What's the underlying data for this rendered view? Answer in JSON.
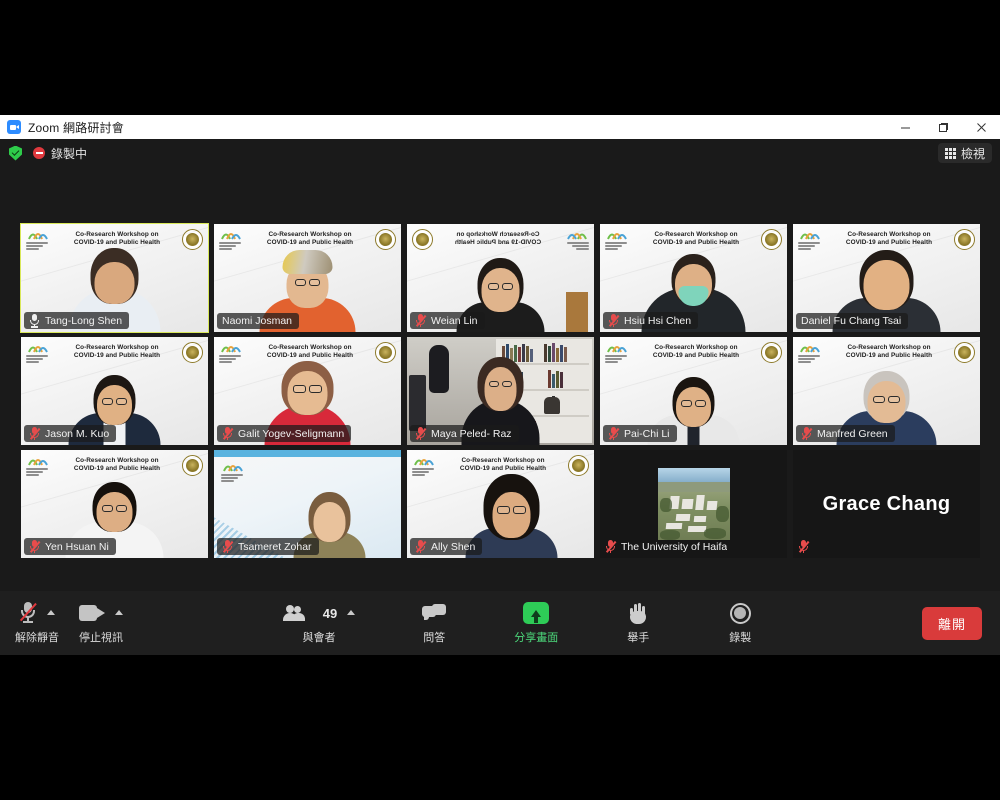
{
  "window": {
    "title": "Zoom 網路研討會",
    "app_icon": "zoom-video-icon",
    "minimize_label": "—",
    "maximize_label": "❐",
    "close_label": "✕"
  },
  "status_bar": {
    "encryption_icon": "green-shield-check-icon",
    "recording_icon": "recording-indicator-icon",
    "recording_label": "錄製中",
    "view_button": {
      "icon": "grid-view-icon",
      "label": "檢視"
    }
  },
  "virtual_background": {
    "banner_line1": "Co-Research Workshop on",
    "banner_line2": "COVID-19 and Public Health",
    "left_logo": "university-of-haifa-logo",
    "right_logo": "ntu-seal-logo"
  },
  "grid": {
    "columns": 5,
    "rows": 3,
    "participants": [
      {
        "name": "Tang-Long Shen",
        "muted": false,
        "active_speaker": true,
        "background": "workshop-banner",
        "plate": "box"
      },
      {
        "name": "Naomi Josman",
        "muted": false,
        "active_speaker": false,
        "background": "workshop-banner",
        "plate": "box",
        "no_mic_icon": true
      },
      {
        "name": "Weian Lin",
        "muted": true,
        "active_speaker": false,
        "background": "workshop-banner-mirrored",
        "plate": "box"
      },
      {
        "name": "Hsiu Hsi Chen",
        "muted": true,
        "active_speaker": false,
        "background": "workshop-banner",
        "plate": "box"
      },
      {
        "name": "Daniel Fu Chang Tsai",
        "muted": false,
        "active_speaker": false,
        "background": "workshop-banner",
        "plate": "box",
        "no_mic_icon": true
      },
      {
        "name": "Jason M. Kuo",
        "muted": true,
        "active_speaker": false,
        "background": "workshop-banner",
        "plate": "box"
      },
      {
        "name": "Galit Yogev-Seligmann",
        "muted": true,
        "active_speaker": false,
        "background": "workshop-banner",
        "plate": "box"
      },
      {
        "name": "Maya Peled- Raz",
        "muted": true,
        "active_speaker": false,
        "background": "bookshelf-room",
        "plate": "box"
      },
      {
        "name": "Pai-Chi Li",
        "muted": true,
        "active_speaker": false,
        "background": "workshop-banner",
        "plate": "box"
      },
      {
        "name": "Manfred Green",
        "muted": true,
        "active_speaker": false,
        "background": "workshop-banner",
        "plate": "box"
      },
      {
        "name": "Yen Hsuan Ni",
        "muted": true,
        "active_speaker": false,
        "background": "workshop-banner",
        "plate": "box"
      },
      {
        "name": "Tsameret Zohar",
        "muted": true,
        "active_speaker": false,
        "background": "blue-gradient",
        "plate": "box"
      },
      {
        "name": "Ally Shen",
        "muted": true,
        "active_speaker": false,
        "background": "workshop-banner",
        "plate": "box"
      },
      {
        "name": "The University of Haifa",
        "muted": true,
        "active_speaker": false,
        "background": "avatar-photo",
        "plate": "bare"
      },
      {
        "name": "Grace Chang",
        "muted": true,
        "active_speaker": false,
        "background": "name-only",
        "plate": "bare",
        "hide_plate_name": true
      }
    ]
  },
  "toolbar": {
    "mute": {
      "icon": "mic-muted-icon",
      "label": "解除靜音",
      "has_caret": true
    },
    "video": {
      "icon": "camera-icon",
      "label": "停止視訊",
      "has_caret": true
    },
    "participants": {
      "icon": "participants-icon",
      "label": "與會者",
      "count": "49",
      "has_caret": true
    },
    "qa": {
      "icon": "chat-bubbles-icon",
      "label": "問答"
    },
    "share": {
      "icon": "share-screen-icon",
      "label": "分享畫面",
      "highlight_color": "#4cd97b"
    },
    "raise_hand": {
      "icon": "raised-hand-icon",
      "label": "舉手"
    },
    "record": {
      "icon": "record-circle-icon",
      "label": "錄製"
    },
    "leave": {
      "label": "離開",
      "color": "#d93b3b"
    }
  }
}
